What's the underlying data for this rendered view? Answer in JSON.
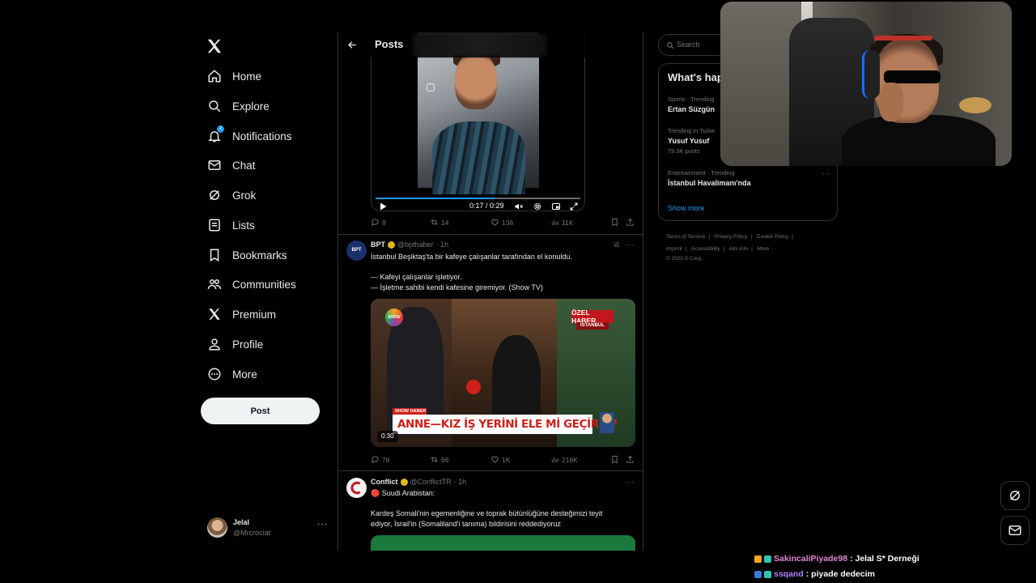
{
  "nav": {
    "items": [
      {
        "label": "Home",
        "icon": "home-icon"
      },
      {
        "label": "Explore",
        "icon": "search-icon"
      },
      {
        "label": "Notifications",
        "icon": "bell-icon",
        "badge": "2"
      },
      {
        "label": "Chat",
        "icon": "mail-icon"
      },
      {
        "label": "Grok",
        "icon": "grok-icon"
      },
      {
        "label": "Lists",
        "icon": "list-icon"
      },
      {
        "label": "Bookmarks",
        "icon": "bookmark-icon"
      },
      {
        "label": "Communities",
        "icon": "communities-icon"
      },
      {
        "label": "Premium",
        "icon": "x-icon"
      },
      {
        "label": "Profile",
        "icon": "profile-icon"
      },
      {
        "label": "More",
        "icon": "more-icon"
      }
    ],
    "post_label": "Post",
    "account": {
      "name": "Jelal",
      "handle": "@Mrcrociat",
      "more": "···"
    }
  },
  "header": {
    "title": "Posts"
  },
  "video1": {
    "time": "0:17 / 0:29",
    "progress": 0.58
  },
  "tweet0_actions": {
    "replies": "8",
    "reposts": "14",
    "likes": "136",
    "views": "11K"
  },
  "tweet1": {
    "name": "BPT",
    "handle": "@bpthaber",
    "time": "· 1h",
    "avatar_text": "BPT",
    "lines": [
      "İstanbul Beşiktaş'ta bir kafeye çalışanlar tarafından el konuldu.",
      "",
      "— Kafeyi çalışanlar işletiyor.",
      "— İşletme sahibi kendi kafesine giremiyor. (Show TV)"
    ],
    "media": {
      "banner": "ANNE—KIZ İŞ YERİNİ ELE Mİ GEÇİRDİ?",
      "ozel": "ÖZEL HABER",
      "city": "İSTANBUL",
      "duration": "0:30",
      "tag": "SHOW HABER",
      "logo": "SHOW"
    },
    "actions": {
      "replies": "78",
      "reposts": "66",
      "likes": "1K",
      "views": "216K"
    }
  },
  "tweet2": {
    "name": "Conflict",
    "handle": "@ConflictTR",
    "time": "· 1h",
    "lines": [
      "🔴 Suudi Arabistan:",
      "",
      "Kardeş Somali'nin egemenliğine ve toprak bütünlüğüne desteğimizi teyit",
      "ediyor, İsrail'in (Somaliland'i tanıma) bildirisini reddediyoruz"
    ]
  },
  "search": {
    "placeholder": "Search"
  },
  "trends": {
    "title": "What's hap",
    "items": [
      {
        "context": "Sports · Trending",
        "name": "Ertan Süzgün",
        "count": ""
      },
      {
        "context": "Trending in Turke",
        "name": "Yusuf Yusuf",
        "count": "75.3K posts"
      },
      {
        "context": "Entertainment · Trending",
        "name": "İstanbul Havalimanı'nda",
        "count": ""
      }
    ],
    "show_more": "Show more"
  },
  "footer": {
    "links": [
      "Terms of Service",
      "|",
      "Privacy Policy",
      "|",
      "Cookie Policy",
      "|",
      "Imprint",
      "|",
      "Accessibility",
      "|",
      "Ads info",
      "|",
      "More ···"
    ],
    "copyright": "© 2025 X Corp."
  },
  "chat": [
    {
      "user": "SakincaliPiyade98",
      "message": ": Jelal S* Derneği"
    },
    {
      "user": "ssqand",
      "message": ": piyade dedecim"
    }
  ],
  "colors": {
    "accent": "#1d9bf0",
    "background": "#000000",
    "border": "#2f3336",
    "muted": "#71767b"
  }
}
